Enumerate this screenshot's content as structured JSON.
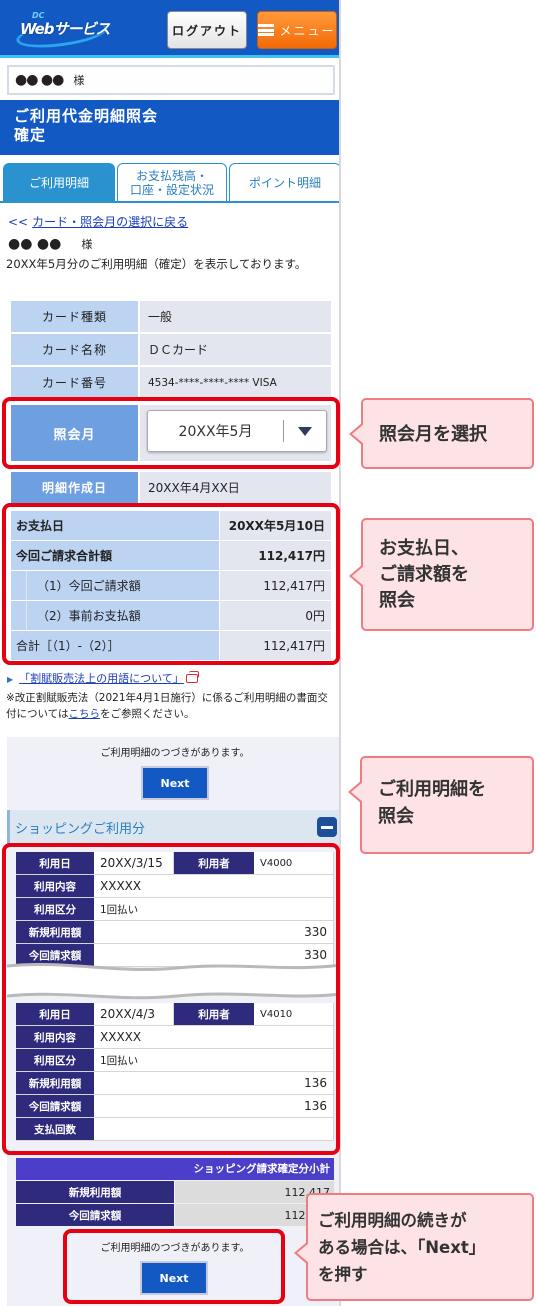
{
  "header": {
    "logo_small": "DC",
    "logo_text": "Webサービス",
    "logout_label": "ログアウト",
    "menu_label": "メニュー"
  },
  "user": {
    "name_masked": "●● ●●",
    "honorific": "様"
  },
  "page_title": {
    "line1": "ご利用代金明細照会",
    "line2": "確定"
  },
  "tabs": [
    {
      "label": "ご利用明細",
      "active": true
    },
    {
      "label_line1": "お支払残高・",
      "label_line2": "口座・設定状況",
      "active": false
    },
    {
      "label": "ポイント明細",
      "active": false
    }
  ],
  "back_link": {
    "chevron": "<<",
    "label": "カード・照会月の選択に戻る"
  },
  "notice": "20XX年5月分のご利用明細（確定）を表示しております。",
  "card_info": [
    {
      "label": "カード種類",
      "value": "一般"
    },
    {
      "label": "カード名称",
      "value": "ＤＣカード"
    },
    {
      "label": "カード番号",
      "value": "4534-****-****-**** VISA"
    }
  ],
  "inquiry_month": {
    "label": "照会月",
    "selected": "20XX年5月"
  },
  "statement_date": {
    "label": "明細作成日",
    "value": "20XX年4月XX日"
  },
  "payment": {
    "rows": [
      {
        "label": "お支払日",
        "value": "20XX年5月10日"
      },
      {
        "label": "今回ご請求合計額",
        "value": "112,417円"
      },
      {
        "label": "（1）今回ご請求額",
        "value": "112,417円"
      },
      {
        "label": "（2）事前お支払額",
        "value": "0円"
      },
      {
        "label": "合計［（1）-（2）］",
        "value": "112,417円"
      }
    ]
  },
  "terms_link": "「割賦販売法上の用語について」",
  "legal_note": {
    "before": "※改正割賦販売法（2021年4月1日施行）に係るご利用明細の書面交付については",
    "link": "こちら",
    "after": "をご参照ください。"
  },
  "continuation": {
    "message": "ご利用明細のつづきがあります。",
    "next_label": "Next"
  },
  "shopping": {
    "section_title": "ショッピングご利用分",
    "labels": {
      "date": "利用日",
      "user": "利用者",
      "content": "利用内容",
      "type": "利用区分",
      "new_amount": "新規利用額",
      "billed_amount": "今回請求額",
      "installments": "支払回数"
    },
    "entries": [
      {
        "date": "20XX/3/15",
        "user": "V4000",
        "content": "XXXXX",
        "type": "1回払い",
        "new_amount": "330",
        "billed_amount": "330"
      },
      {
        "date": "20XX/4/3",
        "user": "V4010",
        "content": "XXXXX",
        "type": "1回払い",
        "new_amount": "136",
        "billed_amount": "136",
        "installments": ""
      }
    ],
    "subtotal": {
      "title": "ショッピング請求確定分小計",
      "rows": [
        {
          "label": "新規利用額",
          "value": "112,417"
        },
        {
          "label": "今回請求額",
          "value": "112,417"
        }
      ]
    }
  },
  "callouts": {
    "select_month": "照会月を選択",
    "payment_line1": "お支払日、",
    "payment_line2": "ご請求額を",
    "payment_line3": "照会",
    "details_line1": "ご利用明細を",
    "details_line2": "照会",
    "next_line1": "ご利用明細の続きが",
    "next_line2": "ある場合は、「Next」",
    "next_line3": "を押す"
  },
  "colors": {
    "header_blue": "#1359c4",
    "tab_blue": "#2a93cf",
    "highlight_red": "#e60012",
    "callout_bg": "#fde3e5",
    "menu_orange": "#f36a07",
    "table_navy": "#2e2a7c"
  }
}
